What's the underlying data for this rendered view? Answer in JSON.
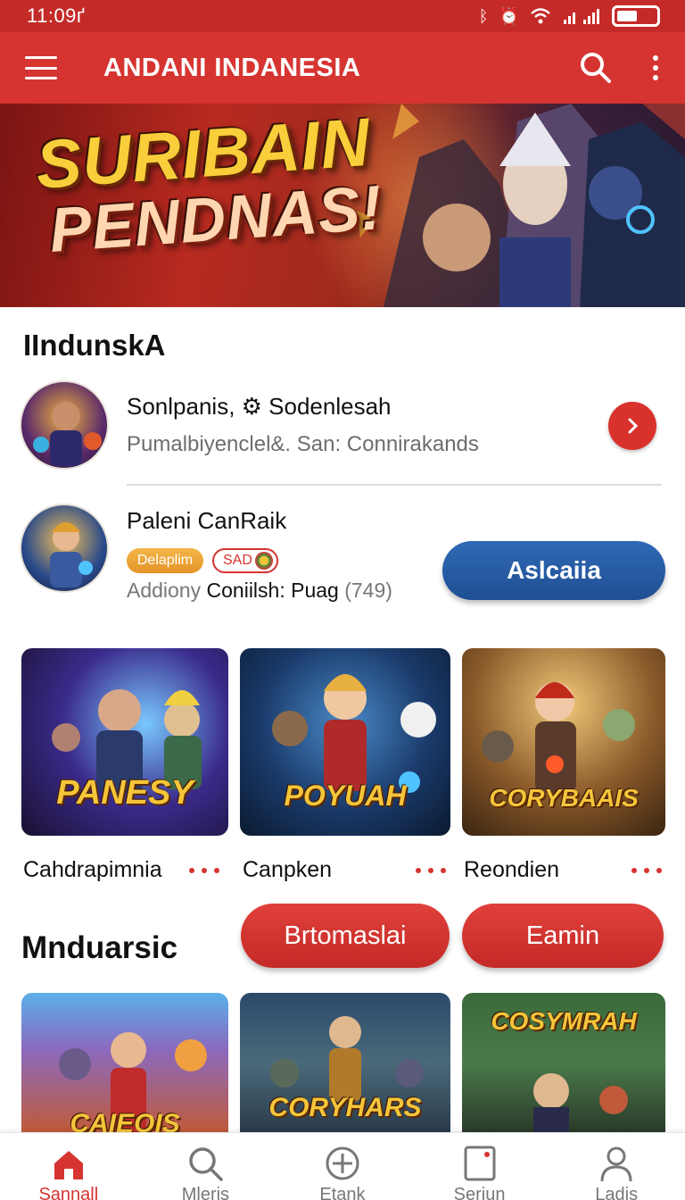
{
  "status_bar": {
    "time": "11:09ґ",
    "battery_level": 0.5
  },
  "app_bar": {
    "title": "ANDANI INDANESIA",
    "menu_icon": "hamburger-menu-icon",
    "search_icon": "search-icon",
    "more_icon": "more-vertical-icon"
  },
  "hero": {
    "line1": "SURIBAIN",
    "line2": "PENDNAS!"
  },
  "section1": {
    "title": "IIndunskA",
    "item1": {
      "name": "Sonlpanis, ⚙ Sodenlesah",
      "subtitle": "Pumalbiyenclel&. San: Connirakands"
    },
    "item2": {
      "name": "Paleni CanRaik",
      "badge1": "Delaplim",
      "badge2": "SAD",
      "meta_prefix": "Addiony",
      "meta_bold": "Coniilsh: Puag",
      "meta_count": "(749)",
      "action": "Aslcaiia"
    }
  },
  "cards_row1": [
    {
      "label": "Cahdrapimnia",
      "logo": "PANESY"
    },
    {
      "label": "Canpken",
      "logo": "POYUAH"
    },
    {
      "label": "Reondien",
      "logo": "CORYBAAIS"
    }
  ],
  "section2": {
    "title": "Mnduarsic",
    "button1": "Brtomaslai",
    "button2": "Eamin"
  },
  "cards_row2": [
    {
      "logo": "CAIEOIS"
    },
    {
      "logo": "CORYHARS"
    },
    {
      "logo": "COSYMRAH"
    }
  ],
  "bottom_nav": [
    {
      "label": "Sannall",
      "icon": "home-icon",
      "active": true
    },
    {
      "label": "Mleris",
      "icon": "search-icon",
      "active": false
    },
    {
      "label": "Etank",
      "icon": "add-circle-icon",
      "active": false
    },
    {
      "label": "Serjun",
      "icon": "library-icon",
      "active": false
    },
    {
      "label": "Ladis",
      "icon": "profile-icon",
      "active": false
    }
  ],
  "colors": {
    "primary_red": "#d63431",
    "action_blue": "#2f69b6",
    "badge_gold": "#f3b648"
  }
}
